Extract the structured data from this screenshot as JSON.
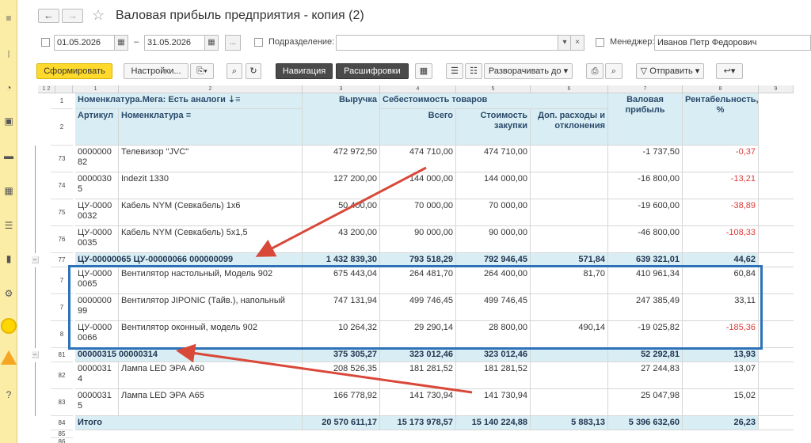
{
  "window": {
    "title": "Валовая прибыль предприятия - копия (2)",
    "back": "←",
    "forward": "→",
    "star": "☆"
  },
  "filters": {
    "date_from": "01.05.2026",
    "date_to": "31.05.2026",
    "dash": "–",
    "dots": "...",
    "division_label": "Подразделение:",
    "division_value": "",
    "manager_label": "Менеджер:",
    "manager_value": "Иванов Петр Федорович"
  },
  "toolbar": {
    "generate": "Сформировать",
    "settings": "Настройки...",
    "navigation": "Навигация",
    "decode": "Расшифровки",
    "expand": "Разворачивать до",
    "send": "Отправить",
    "arrow_down": "▾"
  },
  "headers": {
    "col_numbers": [
      "1",
      "2",
      "3",
      "4",
      "5",
      "6",
      "7",
      "8",
      "9"
    ],
    "row1_num": "1",
    "row2_num": "2",
    "nomenclature_group": "Номенклатура.Мега: Есть аналоги",
    "article": "Артикул",
    "nomenclature": "Номенклатура",
    "revenue": "Выручка",
    "cost_group": "Себестоимость товаров",
    "cost_total": "Всего",
    "cost_purchase": "Стоимость закупки",
    "cost_extra": "Доп. расходы и отклонения",
    "gross_profit": "Валовая прибыль",
    "profitability": "Рентабельность, %"
  },
  "rows": [
    {
      "num": "73",
      "article": "0000000 82",
      "name": "Телевизор \"JVC\"",
      "revenue": "472 972,50",
      "total": "474 710,00",
      "purchase": "474 710,00",
      "extra": "",
      "profit": "-1 737,50",
      "rent": "-0,37",
      "neg": true,
      "grp": false
    },
    {
      "num": "74",
      "article": "0000030 5",
      "name": "Indezit 1330",
      "revenue": "127 200,00",
      "total": "144 000,00",
      "purchase": "144 000,00",
      "extra": "",
      "profit": "-16 800,00",
      "rent": "-13,21",
      "neg": true,
      "grp": false
    },
    {
      "num": "75",
      "article": "ЦУ-0000 0032",
      "name": "Кабель NYM (Севкабель) 1х6",
      "revenue": "50 400,00",
      "total": "70 000,00",
      "purchase": "70 000,00",
      "extra": "",
      "profit": "-19 600,00",
      "rent": "-38,89",
      "neg": true,
      "grp": false
    },
    {
      "num": "76",
      "article": "ЦУ-0000 0035",
      "name": "Кабель NYM (Севкабель) 5х1,5",
      "revenue": "43 200,00",
      "total": "90 000,00",
      "purchase": "90 000,00",
      "extra": "",
      "profit": "-46 800,00",
      "rent": "-108,33",
      "neg": true,
      "grp": false
    },
    {
      "num": "77",
      "article": "ЦУ-00000065 ЦУ-00000066 000000099",
      "name": "",
      "revenue": "1 432 839,30",
      "total": "793 518,29",
      "purchase": "792 946,45",
      "extra": "571,84",
      "profit": "639 321,01",
      "rent": "44,62",
      "neg": false,
      "grp": true
    },
    {
      "num": "7",
      "article": "ЦУ-0000 0065",
      "name": "Вентилятор настольный, Модель 902",
      "revenue": "675 443,04",
      "total": "264 481,70",
      "purchase": "264 400,00",
      "extra": "81,70",
      "profit": "410 961,34",
      "rent": "60,84",
      "neg": false,
      "grp": false
    },
    {
      "num": "7",
      "article": "0000000 99",
      "name": "Вентилятор JIPONIC (Тайв.), напольный",
      "revenue": "747 131,94",
      "total": "499 746,45",
      "purchase": "499 746,45",
      "extra": "",
      "profit": "247 385,49",
      "rent": "33,11",
      "neg": false,
      "grp": false
    },
    {
      "num": "8",
      "article": "ЦУ-0000 0066",
      "name": "Вентилятор оконный, модель 902",
      "revenue": "10 264,32",
      "total": "29 290,14",
      "purchase": "28 800,00",
      "extra": "490,14",
      "profit": "-19 025,82",
      "rent": "-185,36",
      "neg": true,
      "grp": false
    },
    {
      "num": "81",
      "article": "00000315 00000314",
      "name": "",
      "revenue": "375 305,27",
      "total": "323 012,46",
      "purchase": "323 012,46",
      "extra": "",
      "profit": "52 292,81",
      "rent": "13,93",
      "neg": false,
      "grp": true
    },
    {
      "num": "82",
      "article": "0000031 4",
      "name": "Лампа LED ЭРА А60",
      "revenue": "208 526,35",
      "total": "181 281,52",
      "purchase": "181 281,52",
      "extra": "",
      "profit": "27 244,83",
      "rent": "13,07",
      "neg": false,
      "grp": false
    },
    {
      "num": "83",
      "article": "0000031 5",
      "name": "Лампа LED ЭРА А65",
      "revenue": "166 778,92",
      "total": "141 730,94",
      "purchase": "141 730,94",
      "extra": "",
      "profit": "25 047,98",
      "rent": "15,02",
      "neg": false,
      "grp": false
    },
    {
      "num": "84",
      "article": "Итого",
      "name": "",
      "revenue": "20 570 611,17",
      "total": "15 173 978,57",
      "purchase": "15 140 224,88",
      "extra": "5 883,13",
      "profit": "5 396 632,60",
      "rent": "26,23",
      "neg": false,
      "grp": true
    }
  ],
  "extra_rows": [
    "85",
    "86"
  ],
  "colors": {
    "header_bg": "#d9eef4",
    "negative": "#e03a3a",
    "annotation_box": "#2d72b8",
    "annotation_arrow": "#d9493a",
    "sidebar": "#fbeca6"
  }
}
